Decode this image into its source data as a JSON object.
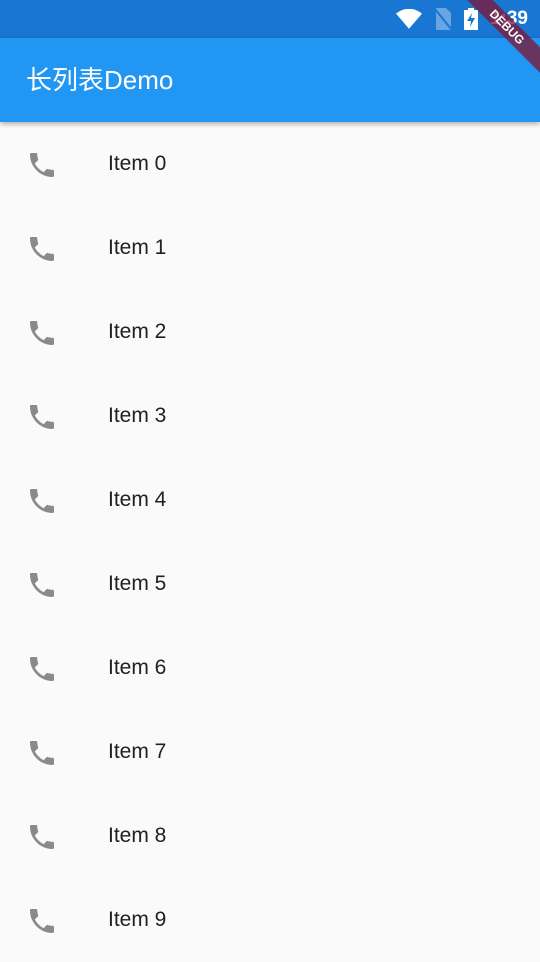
{
  "status_bar": {
    "time": "1:39"
  },
  "app_bar": {
    "title": "长列表Demo"
  },
  "debug_banner": "DEBUG",
  "list": {
    "items": [
      {
        "label": "Item 0",
        "icon": "phone-icon"
      },
      {
        "label": "Item 1",
        "icon": "phone-icon"
      },
      {
        "label": "Item 2",
        "icon": "phone-icon"
      },
      {
        "label": "Item 3",
        "icon": "phone-icon"
      },
      {
        "label": "Item 4",
        "icon": "phone-icon"
      },
      {
        "label": "Item 5",
        "icon": "phone-icon"
      },
      {
        "label": "Item 6",
        "icon": "phone-icon"
      },
      {
        "label": "Item 7",
        "icon": "phone-icon"
      },
      {
        "label": "Item 8",
        "icon": "phone-icon"
      },
      {
        "label": "Item 9",
        "icon": "phone-icon"
      }
    ]
  },
  "colors": {
    "status_bar": "#1976D2",
    "app_bar": "#2196F3",
    "icon": "#8a8a8a"
  }
}
